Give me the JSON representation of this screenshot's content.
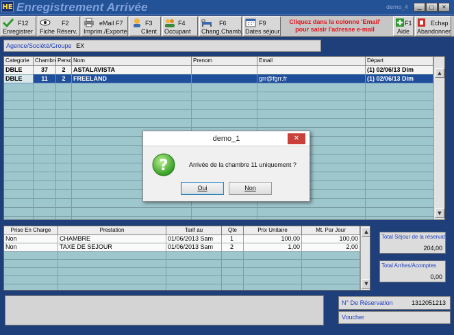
{
  "window": {
    "logo": "HE",
    "title": "Enregistrement Arrivée",
    "demo_tag": "demo_4",
    "buttons": {
      "minimize": "▁",
      "maximize": "□",
      "close": "✕"
    }
  },
  "toolbar": {
    "buttons": [
      {
        "key": "F12",
        "label": "Enregistrer",
        "icon": "check-icon"
      },
      {
        "key": "F2",
        "label": "Fiche Réserv.",
        "icon": "eye-icon"
      },
      {
        "key": "eMail F7",
        "label": "Imprim./Exporte",
        "icon": "printer-icon"
      },
      {
        "key": "F3",
        "label": "Client",
        "icon": "person-icon"
      },
      {
        "key": "F4",
        "label": "Occupant",
        "icon": "people-icon"
      },
      {
        "key": "F6",
        "label": "Chang.Chamb.",
        "icon": "bed-icon"
      },
      {
        "key": "F9",
        "label": "Dates séjour",
        "icon": "calendar-icon"
      },
      {
        "key": "F1",
        "label": "Aide",
        "icon": "help-plus-icon"
      },
      {
        "key": "Echap",
        "label": "Abandonner",
        "icon": "exit-icon"
      }
    ],
    "notice_line1": "Cliquez dans la colonne 'Email'",
    "notice_line2": "pour saisir l'adresse e-mail"
  },
  "agency": {
    "label": "Agence/Société/Groupe",
    "value": "EX"
  },
  "rooms_table": {
    "headers": [
      "Categorie",
      "Chambre",
      "Perso",
      "Nom",
      "Prenom",
      "Email",
      "Départ"
    ],
    "rows": [
      {
        "categorie": "DBLE",
        "chambre": "37",
        "perso": "2",
        "nom": "ASTALAVISTA",
        "prenom": "",
        "email": "",
        "depart": "(1) 02/06/13 Dim"
      },
      {
        "categorie": "DBLE",
        "chambre": "11",
        "perso": "2",
        "nom": "FREELAND",
        "prenom": "",
        "email": "grr@fgrr.fr",
        "depart": "(1) 02/06/13 Dim"
      }
    ]
  },
  "services_table": {
    "headers": [
      "Prise En Charge",
      "Prestation",
      "Tarif au",
      "Qte",
      "Prix Unitaire",
      "Mt. Par Jour"
    ],
    "rows": [
      {
        "prise": "Non",
        "prestation": "CHAMBRE",
        "tarif": "01/06/2013 Sam",
        "qte": "1",
        "prix": "100,00",
        "mt": "100,00"
      },
      {
        "prise": "Non",
        "prestation": "TAXE DE SEJOUR",
        "tarif": "01/06/2013 Sam",
        "qte": "2",
        "prix": "1,00",
        "mt": "2,00"
      }
    ]
  },
  "totals": {
    "sejour_label": "Total Séjour de la réservation",
    "sejour_value": "204,00",
    "arrhes_label": "Total Arrhes/Acomptes",
    "arrhes_value": "0,00"
  },
  "reservation": {
    "label": "N° De Réservation",
    "value": "1312051213"
  },
  "voucher": {
    "label": "Voucher"
  },
  "dialog": {
    "title": "demo_1",
    "message": "Arrivée de la chambre   11 uniquement ?",
    "yes_label": "Oui",
    "no_label": "Non",
    "close": "✕"
  }
}
